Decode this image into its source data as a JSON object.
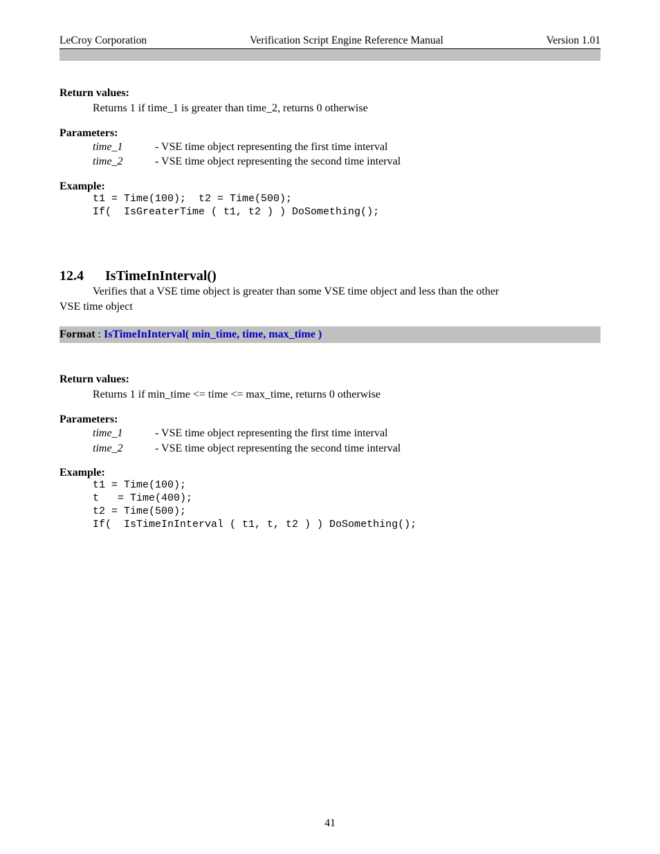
{
  "header": {
    "left": "LeCroy Corporation",
    "center": "Verification Script Engine Reference Manual",
    "right": "Version 1.01"
  },
  "sec1": {
    "return_heading": "Return values:",
    "return_text": "Returns 1 if time_1 is greater than time_2, returns  0 otherwise",
    "params_heading": "Parameters:",
    "params": [
      {
        "name": "time_1",
        "desc": "-  VSE time object representing the first time interval"
      },
      {
        "name": "time_2",
        "desc": "-  VSE time object representing the second time interval"
      }
    ],
    "example_heading": "Example:",
    "code": "t1 = Time(100);  t2 = Time(500);\nIf(  IsGreaterTime ( t1, t2 ) ) DoSomething();"
  },
  "sec2": {
    "num": "12.4",
    "title": "IsTimeInInterval()",
    "desc1": "Verifies that a VSE time object is greater than some VSE time object and less than the other",
    "desc2": "VSE time object",
    "format_label": "Format",
    "format_colon": " :    ",
    "format_sig": "IsTimeInInterval( min_time, time, max_time )",
    "return_heading": "Return values:",
    "return_text": "Returns 1 if  min_time <= time <= max_time, returns  0 otherwise",
    "params_heading": "Parameters:",
    "params": [
      {
        "name": "time_1",
        "desc": "-  VSE time object representing the first time interval"
      },
      {
        "name": "time_2",
        "desc": "-  VSE time object representing the second time interval"
      }
    ],
    "example_heading": "Example:",
    "code": "t1 = Time(100);\nt   = Time(400);\nt2 = Time(500);\nIf(  IsTimeInInterval ( t1, t, t2 ) ) DoSomething();"
  },
  "page_number": "41"
}
